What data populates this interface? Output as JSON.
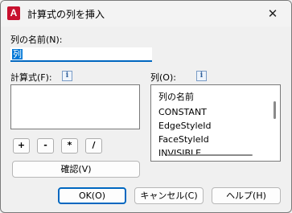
{
  "window": {
    "title": "計算式の列を挿入",
    "app_icon_letter": "A",
    "close_glyph": "✕"
  },
  "column_name": {
    "label": "列の名前(N):",
    "value": "列"
  },
  "formula": {
    "label": "計算式(F):",
    "value": ""
  },
  "columns": {
    "label": "列(O):",
    "items": [
      "列の名前",
      "CONSTANT",
      "EdgeStyleId",
      "FaceStyleId",
      "INVISIBLE"
    ]
  },
  "info_icon_glyph": "i",
  "operators": [
    "+",
    "-",
    "*",
    "/"
  ],
  "buttons": {
    "verify": "確認(V)",
    "ok": "OK(O)",
    "cancel": "キャンセル(C)",
    "help": "ヘルプ(H)"
  },
  "colors": {
    "accent": "#0067c0",
    "selection": "#0078d7",
    "autocad_red": "#c8102e"
  }
}
